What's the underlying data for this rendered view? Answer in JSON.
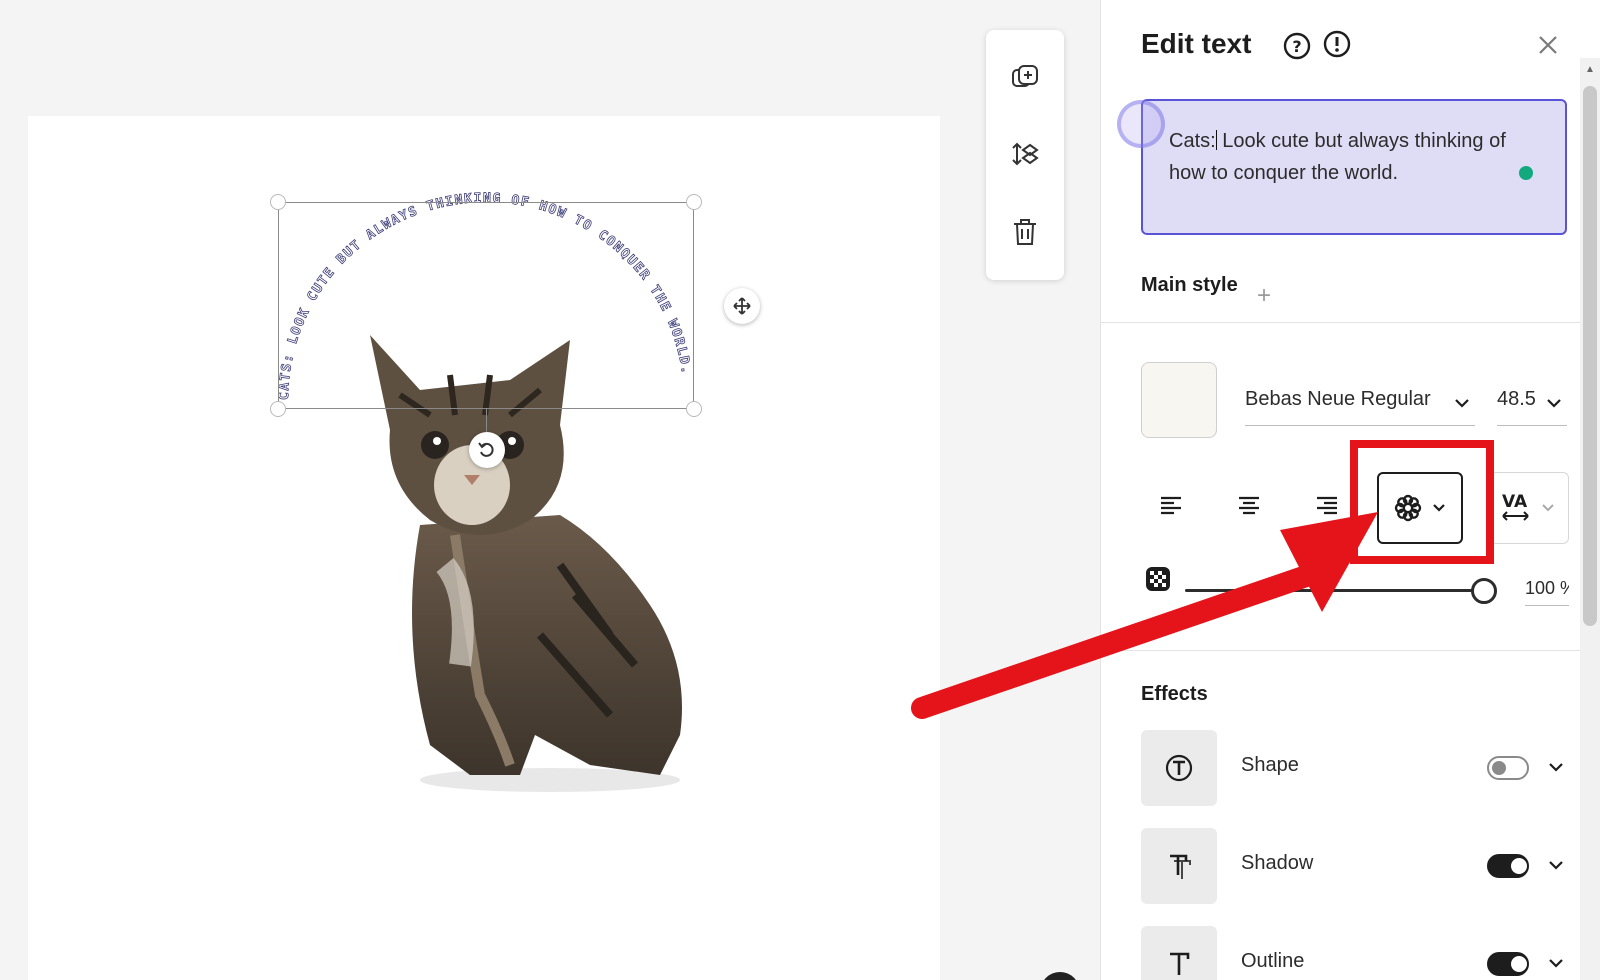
{
  "canvas": {
    "arc_text": "CATS: LOOK CUTE BUT ALWAYS THINKING OF HOW TO CONQUER THE WORLD.",
    "arc_text_color": "#3c3c78"
  },
  "toolbar": {
    "items": [
      {
        "name": "duplicate-icon"
      },
      {
        "name": "arrange-layers-icon"
      },
      {
        "name": "trash-icon"
      }
    ]
  },
  "panel": {
    "title": "Edit text",
    "text_value_before_caret": "Cats:",
    "text_value_after_caret": " Look cute but always thinking of how to conquer the world.",
    "main_style_label": "Main style",
    "font_name": "Bebas Neue Regular",
    "font_size": "48.5",
    "swatch_color": "#f7f6f0",
    "opacity": "100 %",
    "opacity_fraction": 1.0,
    "spacing_label": "VA",
    "effects_label": "Effects",
    "effects": [
      {
        "label": "Shape",
        "enabled": false
      },
      {
        "label": "Shadow",
        "enabled": true
      },
      {
        "label": "Outline",
        "enabled": true
      }
    ]
  },
  "colors": {
    "accent": "#5a53d6",
    "highlight": "#e5141a",
    "status": "#12a97f"
  }
}
